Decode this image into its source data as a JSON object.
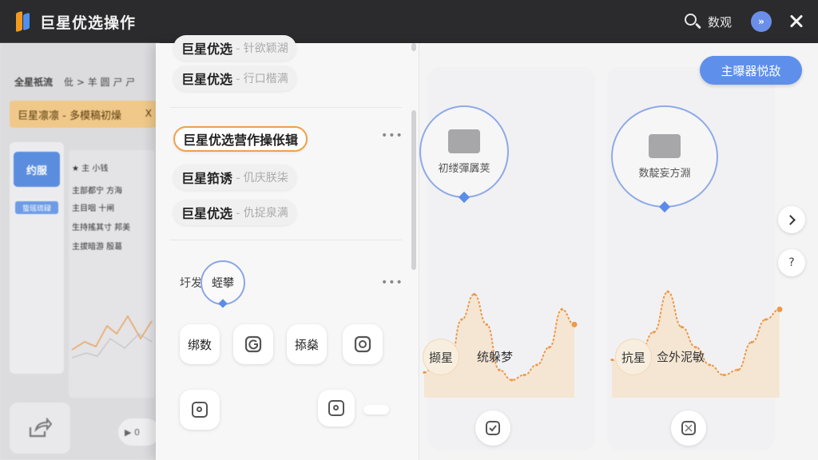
{
  "app": {
    "title": "巨星优选操作"
  },
  "header": {
    "search_label": "数观",
    "avatar_text": "»"
  },
  "background": {
    "crumb_title": "全星祇流",
    "crumb_path": "仳 > 羊 圆 ㄕ ㄕ",
    "banner_text": "巨星凛凛 - 多模稿初燥",
    "banner_close": "X",
    "card_thumb_label": "约服",
    "card_button_label": "蛰瑶琉碌",
    "list_lines": [
      "★ 主 小钱",
      "主部都宁 方海",
      "主目咽 十闸",
      "生持搖其寸 邦美",
      "主拔暗游 殷葛"
    ],
    "pill_text": "▶ 0"
  },
  "list": {
    "items": [
      {
        "main": "巨星优选",
        "sub": "针欲颖湖",
        "active": false
      },
      {
        "main": "巨星优选",
        "sub": "行口楷满",
        "active": false
      },
      {
        "main": "巨星优选营作操伥辑",
        "sub": "",
        "active": true
      },
      {
        "main": "巨星筘诱",
        "sub": "仉庆朕柒",
        "active": false
      },
      {
        "main": "巨星优选",
        "sub": "仇捉泉满",
        "active": false
      }
    ],
    "more_label": "•••",
    "section_label": "圩发",
    "section_bubble": "蛭攀",
    "tools": [
      "绑数",
      "",
      "掭燊",
      ""
    ]
  },
  "cards": [
    {
      "bubble_label": "初缕彈羼荚",
      "chip": "撷星",
      "chart_label": "统躲梦"
    },
    {
      "bubble_label": "数靛妄方淵",
      "chip": "抗星",
      "chart_label": "佥外泥敏"
    }
  ],
  "primary_button": "主曝器悦敌",
  "nav": {
    "next_icon": "chevron-right-icon",
    "help_label": "?"
  },
  "colors": {
    "accent_blue": "#5e8fea",
    "accent_orange": "#f0a04c",
    "chart_line": "#ec9a4a",
    "titlebar": "#2b2b2d"
  },
  "chart_data": [
    {
      "type": "area",
      "x": [
        0,
        1,
        2,
        3,
        4,
        5,
        6,
        7,
        8,
        9,
        10,
        11,
        12
      ],
      "values": [
        20,
        28,
        24,
        62,
        82,
        58,
        22,
        14,
        18,
        26,
        40,
        70,
        58
      ],
      "ylim": [
        0,
        100
      ]
    },
    {
      "type": "area",
      "x": [
        0,
        1,
        2,
        3,
        4,
        5,
        6,
        7,
        8,
        9,
        10,
        11,
        12
      ],
      "values": [
        30,
        24,
        36,
        52,
        84,
        56,
        40,
        26,
        18,
        22,
        44,
        62,
        70
      ],
      "ylim": [
        0,
        100
      ]
    }
  ]
}
